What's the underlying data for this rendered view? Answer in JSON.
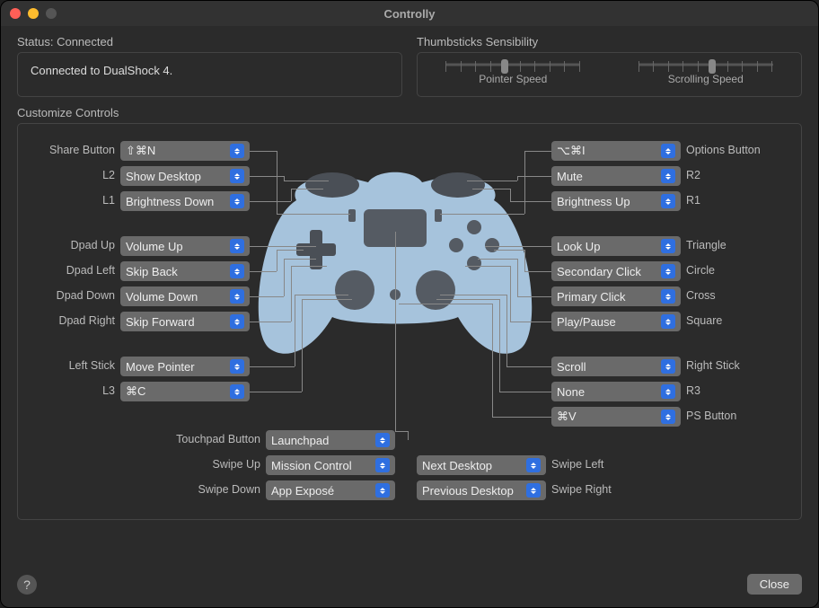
{
  "title": "Controlly",
  "status": {
    "label": "Status: Connected",
    "text": "Connected to DualShock 4."
  },
  "thumb": {
    "label": "Thumbsticks Sensibility",
    "pointer": "Pointer Speed",
    "scrolling": "Scrolling Speed"
  },
  "customize_label": "Customize Controls",
  "left": {
    "share": {
      "label": "Share Button",
      "value": "⇧⌘N"
    },
    "l2": {
      "label": "L2",
      "value": "Show Desktop"
    },
    "l1": {
      "label": "L1",
      "value": "Brightness Down"
    },
    "dpad_up": {
      "label": "Dpad Up",
      "value": "Volume Up"
    },
    "dpad_left": {
      "label": "Dpad Left",
      "value": "Skip Back"
    },
    "dpad_down": {
      "label": "Dpad Down",
      "value": "Volume Down"
    },
    "dpad_right": {
      "label": "Dpad Right",
      "value": "Skip Forward"
    },
    "left_stick": {
      "label": "Left Stick",
      "value": "Move Pointer"
    },
    "l3": {
      "label": "L3",
      "value": "⌘C"
    }
  },
  "right": {
    "options": {
      "label": "Options Button",
      "value": "⌥⌘I"
    },
    "r2": {
      "label": "R2",
      "value": "Mute"
    },
    "r1": {
      "label": "R1",
      "value": "Brightness Up"
    },
    "triangle": {
      "label": "Triangle",
      "value": "Look Up"
    },
    "circle": {
      "label": "Circle",
      "value": "Secondary Click"
    },
    "cross": {
      "label": "Cross",
      "value": "Primary Click"
    },
    "square": {
      "label": "Square",
      "value": "Play/Pause"
    },
    "right_stick": {
      "label": "Right Stick",
      "value": "Scroll"
    },
    "r3": {
      "label": "R3",
      "value": "None"
    },
    "ps": {
      "label": "PS Button",
      "value": "⌘V"
    }
  },
  "bottom": {
    "touchpad": {
      "label": "Touchpad Button",
      "value": "Launchpad"
    },
    "swipe_up": {
      "label": "Swipe Up",
      "value": "Mission Control"
    },
    "swipe_down": {
      "label": "Swipe Down",
      "value": "App Exposé"
    },
    "swipe_left": {
      "label": "Swipe Left",
      "value": "Next Desktop"
    },
    "swipe_right": {
      "label": "Swipe Right",
      "value": "Previous Desktop"
    }
  },
  "help": "?",
  "close": "Close"
}
